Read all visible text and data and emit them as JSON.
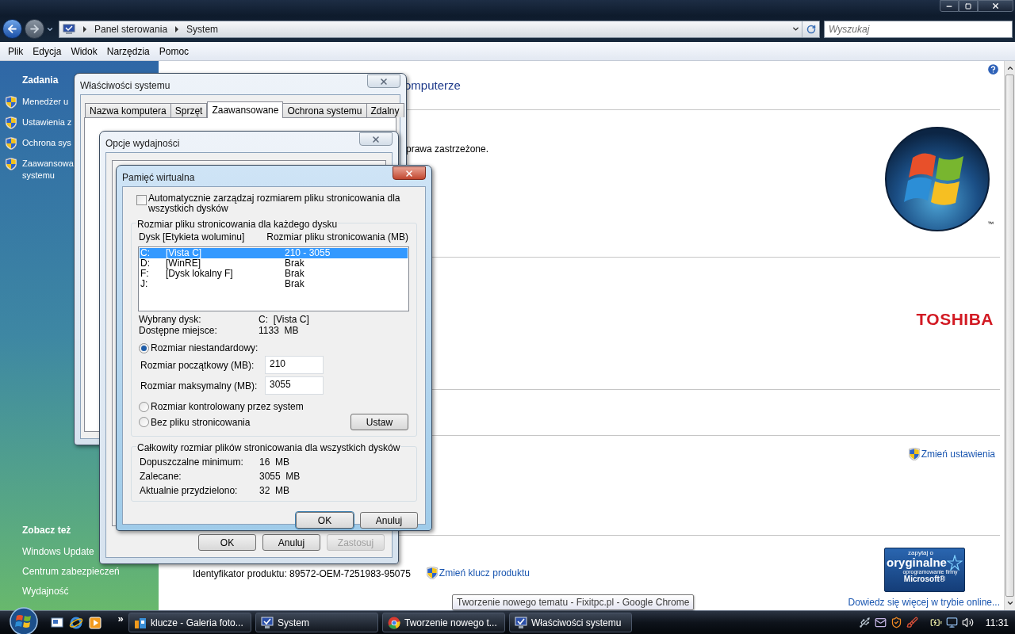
{
  "explorer": {
    "address_path": [
      "Panel sterowania",
      "System"
    ],
    "search": {
      "placeholder": "Wyszukaj"
    },
    "menu": [
      "Plik",
      "Edycja",
      "Widok",
      "Narzędzia",
      "Pomoc"
    ],
    "sidebar": {
      "tasks_title": "Zadania",
      "tasks": [
        {
          "lines": [
            "Menedżer u"
          ]
        },
        {
          "lines": [
            "Ustawienia z"
          ]
        },
        {
          "lines": [
            "Ochrona sys"
          ]
        },
        {
          "lines": [
            "Zaawansowa",
            "systemu"
          ]
        }
      ],
      "see_also_title": "Zobacz też",
      "see_also": [
        "Windows Update",
        "Centrum zabezpieczeń",
        "Wydajność"
      ]
    },
    "content": {
      "heading": "omputerze",
      "copyright": "prawa zastrzeżone.",
      "trademark": "™",
      "oem_logo": "TOSHIBA",
      "change_settings": "Zmień ustawienia",
      "product_id": "Identyfikator produktu: 89572-OEM-7251983-95075",
      "change_key": "Zmień klucz produktu",
      "genuine_badge": {
        "lines": [
          "zapytaj o",
          "oryginalne",
          "oprogramowanie firmy",
          "Microsoft®"
        ]
      },
      "learn_more": "Dowiedz się więcej w trybie online..."
    }
  },
  "system_properties": {
    "title": "Właściwości systemu",
    "tabs": [
      {
        "label": "Nazwa komputera",
        "selected": false
      },
      {
        "label": "Sprzęt",
        "selected": false
      },
      {
        "label": "Zaawansowane",
        "selected": true
      },
      {
        "label": "Ochrona systemu",
        "selected": false
      },
      {
        "label": "Zdalny",
        "selected": false
      }
    ]
  },
  "performance_options": {
    "title": "Opcje wydajności",
    "buttons": [
      {
        "label": "OK",
        "disabled": false
      },
      {
        "label": "Anuluj",
        "disabled": false
      },
      {
        "label": "Zastosuj",
        "disabled": true
      }
    ]
  },
  "virtual_memory": {
    "title": "Pamięć wirtualna",
    "auto_manage": {
      "label": "Automatycznie zarządzaj rozmiarem pliku stronicowania dla wszystkich dysków",
      "checked": false
    },
    "drives_group": "Rozmiar pliku stronicowania dla każdego dysku",
    "columns": [
      "Dysk [Etykieta woluminu]",
      "Rozmiar pliku stronicowania (MB)"
    ],
    "drives": [
      {
        "letter": "C:",
        "label": "[Vista C]",
        "size": "210 - 3055",
        "selected": true
      },
      {
        "letter": "D:",
        "label": "[WinRE]",
        "size": "Brak",
        "selected": false
      },
      {
        "letter": "F:",
        "label": "[Dysk lokalny F]",
        "size": "Brak",
        "selected": false
      },
      {
        "letter": "J:",
        "size": "Brak",
        "selected": false
      }
    ],
    "info": [
      {
        "label": "Wybrany dysk:",
        "value": "C:  [Vista C]"
      },
      {
        "label": "Dostępne miejsce:",
        "value": "1133  MB"
      }
    ],
    "size_options": [
      {
        "label": "Rozmiar niestandardowy:",
        "selected": true
      },
      {
        "label": "Rozmiar kontrolowany przez system",
        "selected": false
      },
      {
        "label": "Bez pliku stronicowania",
        "selected": false
      }
    ],
    "fields": [
      {
        "label": "Rozmiar początkowy (MB):",
        "value": "210"
      },
      {
        "label": "Rozmiar maksymalny (MB):",
        "value": "3055"
      }
    ],
    "set_button": "Ustaw",
    "totals_group": "Całkowity rozmiar plików stronicowania dla wszystkich dysków",
    "totals": [
      {
        "label": "Dopuszczalne minimum:",
        "value": "16  MB"
      },
      {
        "label": "Zalecane:",
        "value": "3055  MB"
      },
      {
        "label": "Aktualnie przydzielono:",
        "value": "32  MB"
      }
    ],
    "buttons": [
      "OK",
      "Anuluj"
    ]
  },
  "tooltip": "Tworzenie nowego tematu - Fixitpc.pl - Google Chrome",
  "taskbar": {
    "overflow": "»",
    "tasks": [
      {
        "kind": "gallery",
        "label": "klucze - Galeria foto..."
      },
      {
        "kind": "system",
        "label": "System"
      },
      {
        "kind": "browser",
        "label": "Tworzenie nowego t..."
      },
      {
        "kind": "system",
        "label": "Właściwości systemu"
      }
    ],
    "clock": "11:31"
  }
}
